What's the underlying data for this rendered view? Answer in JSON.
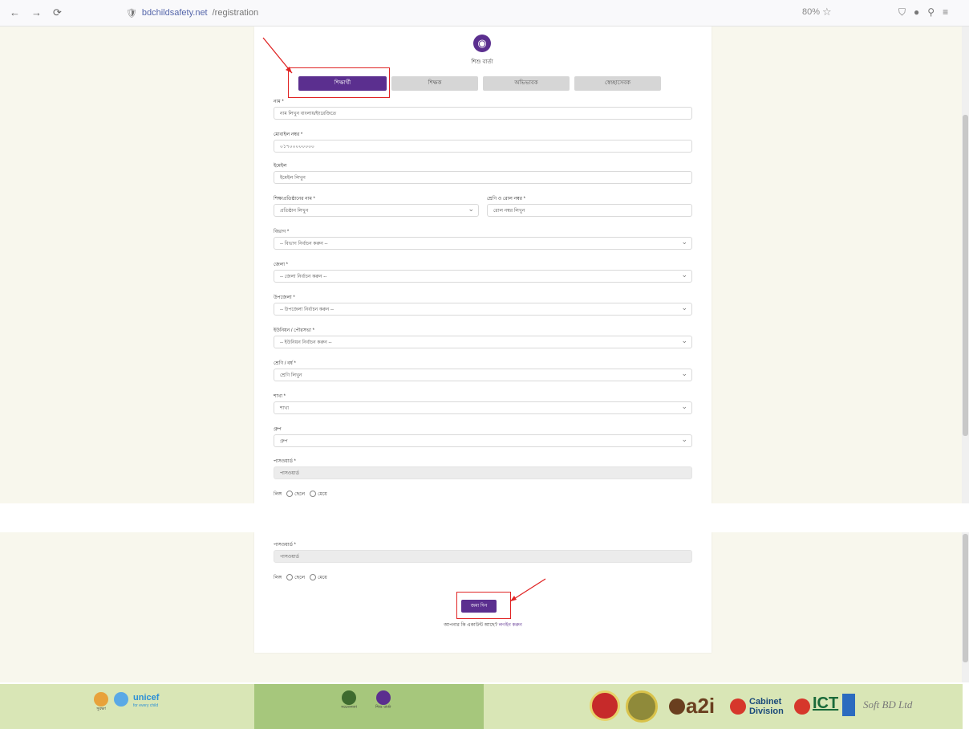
{
  "browser": {
    "url_host": "bdchildsafety.net",
    "url_path": "/registration",
    "zoom": "80%",
    "nav_back": "←",
    "nav_forward": "→",
    "nav_reload": "⟳",
    "star": "☆"
  },
  "form": {
    "logo_caption": "শিশু বার্তা",
    "tabs": [
      "শিক্ষার্থী",
      "শিক্ষক",
      "অভিভাবক",
      "স্বেচ্ছাসেবক"
    ],
    "active_tab": 0,
    "fields": {
      "name": {
        "label": "নাম *",
        "value": "নাম লিখুন বাংলায়/ইংরেজিতে"
      },
      "mobile": {
        "label": "মোবাইল নম্বর *",
        "value": "০১৭০০০০০০০০"
      },
      "email": {
        "label": "ইমেইল",
        "value": "ইমেইল লিখুন"
      },
      "institution": {
        "label": "শিক্ষাপ্রতিষ্ঠানের নাম *",
        "value": "প্রতিষ্ঠান লিখুন"
      },
      "class_roll": {
        "label": "শ্রেণি ও রোল নম্বর *",
        "value": "রোল নম্বর লিখুন"
      },
      "division": {
        "label": "বিভাগ *",
        "value": "-- বিভাগ নির্বাচন করুন --"
      },
      "district": {
        "label": "জেলা *",
        "value": "-- জেলা নির্বাচন করুন --"
      },
      "upazila": {
        "label": "উপজেলা *",
        "value": "-- উপজেলা নির্বাচন করুন --"
      },
      "union": {
        "label": "ইউনিয়ন / পৌরসভা *",
        "value": "-- ইউনিয়ন নির্বাচন করুন --"
      },
      "class": {
        "label": "শ্রেণি / বর্ষ *",
        "value": "শ্রেণি লিখুন"
      },
      "section": {
        "label": "শাখা *",
        "value": "শাখা"
      },
      "group": {
        "label": "গ্রুপ",
        "value": "গ্রুপ"
      },
      "password": {
        "label": "পাসওয়ার্ড *",
        "value": "পাসওয়ার্ড"
      }
    },
    "gender_label": "লিঙ্গ",
    "gender_options": [
      "ছেলে",
      "মেয়ে"
    ],
    "submit_label": "জমা দিন",
    "login_prompt": "আপনার কি একাউন্ট আছে?",
    "login_link": "লগইন করুন"
  },
  "footer": {
    "left_caption": "সুরক্ষা",
    "unicef": "unicef",
    "unicef_tagline": "for every child",
    "mid_captions": [
      "সচেতনতা",
      "শিশু বার্তা"
    ],
    "a2i": "a2i",
    "cabinet_1": "Cabinet",
    "cabinet_2": "Division",
    "ict": "ICT",
    "softbd": "Soft BD Ltd"
  },
  "colors": {
    "brand_purple": "#5b2f8f",
    "page_bg": "#f8f7ed",
    "footer_bg": "#d9e6b6",
    "footer_mid": "#a6c77c",
    "annotation_red": "#e02424"
  }
}
